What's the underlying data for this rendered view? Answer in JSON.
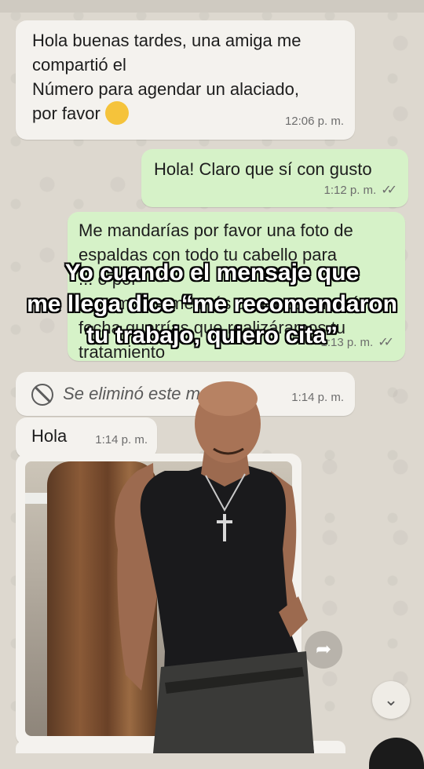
{
  "messages": [
    {
      "id": "m1",
      "direction": "in",
      "text": "Hola buenas tardes, una amiga me\ncompartió el\nNúmero para agendar un alaciado,\npor favor",
      "time": "12:06 p. m."
    },
    {
      "id": "m2",
      "direction": "out",
      "text": "Hola! Claro que sí con gusto",
      "time": "1:12 p. m.",
      "ticks": "✓✓"
    },
    {
      "id": "m3",
      "direction": "out",
      "text": "Me mandarías por favor una foto de\nespaldas con todo tu cabello para\n... o por\n... compártame más o menos en qué\nfecha querrías que realizáramos tu\ntratamiento",
      "time": "1:13 p. m.",
      "ticks": "✓✓"
    },
    {
      "id": "m4",
      "direction": "in",
      "deleted": true,
      "text": "Se eliminó este mensaje.",
      "time": "1:14 p. m."
    },
    {
      "id": "m5",
      "direction": "in",
      "text": "Hola",
      "time": "1:14 p. m."
    }
  ],
  "icons": {
    "deleted": "deleted-message-icon",
    "forward": "forward-icon",
    "scroll_down": "double-chevron-down-icon",
    "emoji": "smiling-face-emoji"
  },
  "caption": {
    "line1": "Yo cuando el mensaje que",
    "line2": "me llega dice “me recomendaron",
    "line3": "tu trabajo, quiero cita”"
  },
  "colors": {
    "incoming": "#f4f2ee",
    "outgoing": "#d6f2c8",
    "background": "#ddd8cf"
  }
}
